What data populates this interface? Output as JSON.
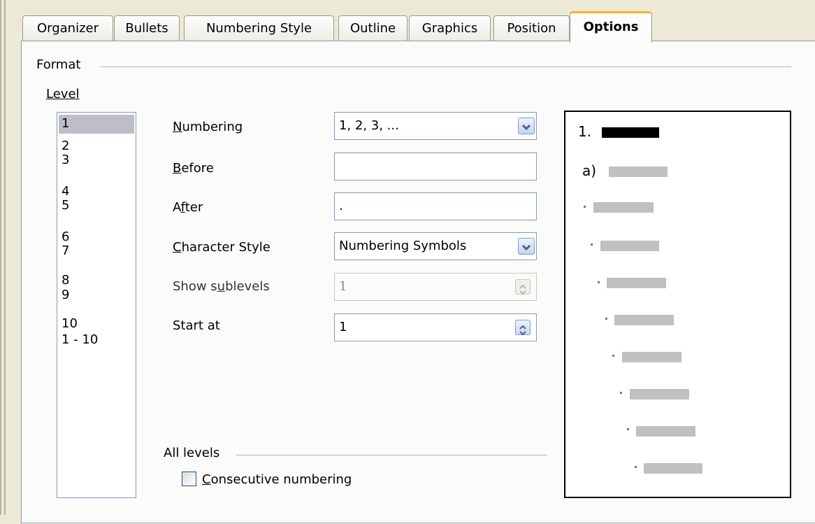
{
  "tabs": [
    {
      "label": "Organizer",
      "active": false
    },
    {
      "label": "Bullets",
      "active": false
    },
    {
      "label": "Numbering Style",
      "active": false
    },
    {
      "label": "Outline",
      "active": false
    },
    {
      "label": "Graphics",
      "active": false
    },
    {
      "label": "Position",
      "active": false
    },
    {
      "label": "Options",
      "active": true
    }
  ],
  "format": {
    "legend": "Format",
    "level_label": "Level",
    "levels": [
      "1",
      "2",
      "3",
      "4",
      "5",
      "6",
      "7",
      "8",
      "9",
      "10",
      "1 - 10"
    ],
    "selected_level": "1"
  },
  "fields": {
    "numbering": {
      "label_pre": "",
      "label_u": "N",
      "label_post": "umbering",
      "value": "1, 2, 3, ..."
    },
    "before": {
      "label_u": "B",
      "label_post": "efore",
      "value": ""
    },
    "after": {
      "label_pre": "A",
      "label_u": "f",
      "label_post": "ter",
      "value": "."
    },
    "character_style": {
      "label_u": "C",
      "label_post": "haracter Style",
      "value": "Numbering Symbols"
    },
    "show_sublevels": {
      "label_pre": "Show s",
      "label_u": "u",
      "label_post": "blevels",
      "value": "1",
      "disabled": true
    },
    "start_at": {
      "label": "Start at",
      "value": "1"
    }
  },
  "all_levels": {
    "legend": "All levels",
    "consecutive_u": "C",
    "consecutive_post": "onsecutive numbering",
    "checked": false
  },
  "preview": {
    "first_label": "1.",
    "second_label": "a)"
  },
  "colors": {
    "active_tab_accent": "#f4b428",
    "selection": "#bdbec6",
    "field_border": "#7f9db9"
  }
}
